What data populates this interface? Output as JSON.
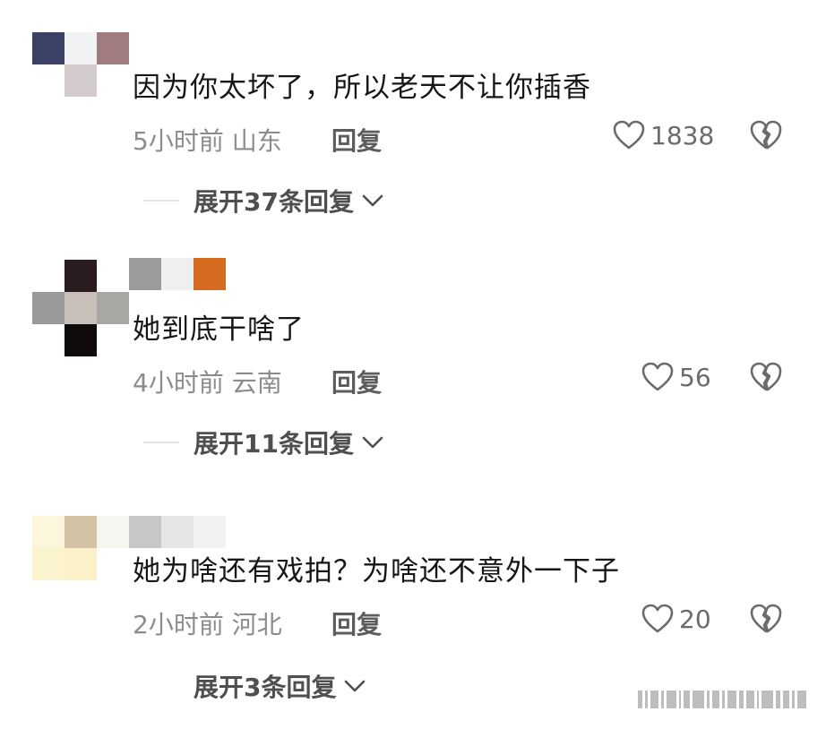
{
  "comments": [
    {
      "text": "因为你太坏了，所以老天不让你插香",
      "time_location": "5小时前 山东",
      "reply_label": "回复",
      "likes": "1838",
      "expand_label": "展开37条回复",
      "avatar_colors": [
        "#3b4266",
        "#f0f2f3",
        "#a07c80",
        "#ffffff",
        "#d3cbcc",
        "#d4c1be",
        "#ffffff",
        "#ffffff",
        "#ffffff"
      ]
    },
    {
      "text": "她到底干啥了",
      "time_location": "4小时前 云南",
      "reply_label": "回复",
      "likes": "56",
      "expand_label": "展开11条回复",
      "avatar_colors": [
        "#ffffff",
        "#2a1c1e",
        "#ffffff",
        "#9a9a9a",
        "#c8c0b8",
        "#a9a7a4",
        "#ffffff",
        "#0f0b0b",
        "#ffffff"
      ],
      "name_colors": [
        "#9b9b9b",
        "#efefef",
        "#d46b1e"
      ]
    },
    {
      "text": "她为啥还有戏拍？为啥还不意外一下子",
      "time_location": "2小时前 河北",
      "reply_label": "回复",
      "likes": "20",
      "expand_label": "展开3条回复",
      "avatar_colors": [
        "#fcf6dc",
        "#d3c2a4",
        "#f6f5f0",
        "#faf3cd",
        "#fbf1c9",
        "#ffffff",
        "#ffffff",
        "#ffffff",
        "#ffffff"
      ],
      "name_colors": [
        "#c7c7c7",
        "#e6e6e6",
        "#f2f2f2"
      ]
    }
  ],
  "icons": [
    "heart-icon",
    "broken-heart-icon",
    "chevron-down-icon"
  ]
}
